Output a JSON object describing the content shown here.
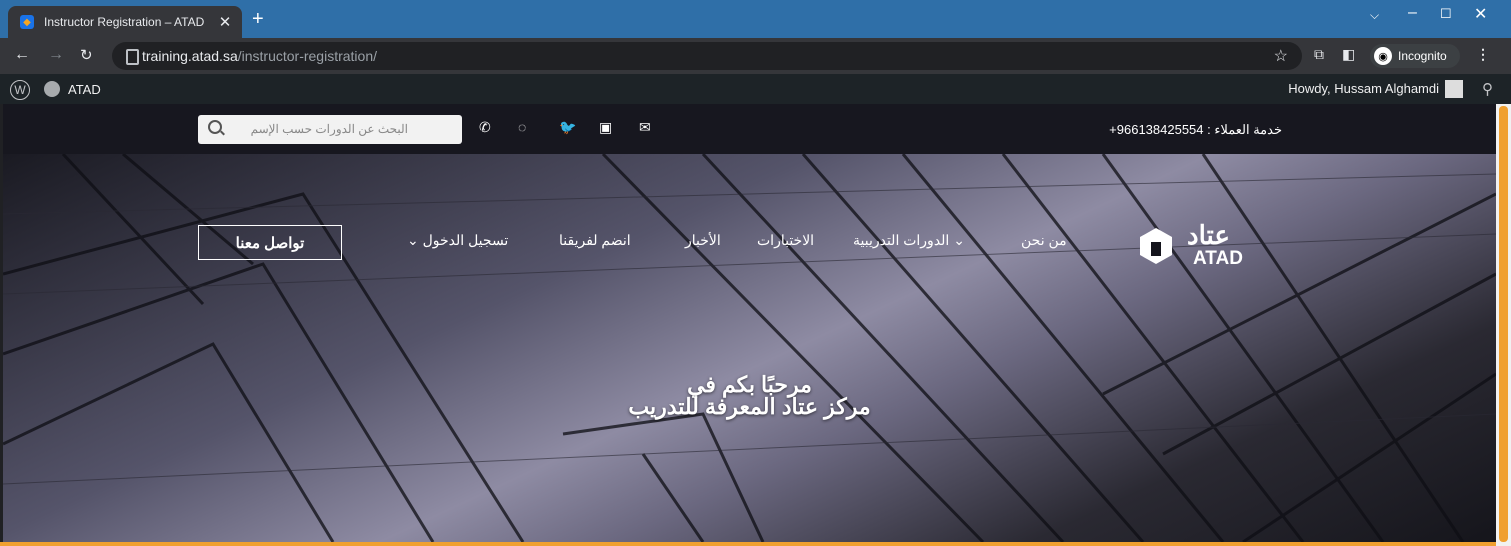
{
  "browser": {
    "tab_title": "Instructor Registration – ATAD",
    "url_domain": "training.atad.sa",
    "url_path": "/instructor-registration/",
    "incognito_label": "Incognito"
  },
  "wp_admin": {
    "site_name": "ATAD",
    "howdy": "Howdy, Hussam Alghamdi"
  },
  "topbar": {
    "search_placeholder": "البحث عن الدورات حسب الإسم",
    "customer_service": "خدمة العملاء : 966138425554+"
  },
  "nav": {
    "about": "من نحن",
    "courses": "الدورات التدريبية",
    "exams": "الاختبارات",
    "news": "الأخبار",
    "join": "انضم لفريقنا",
    "login": "تسجيل الدخول",
    "contact_button": "تواصل معنا"
  },
  "logo": {
    "arabic": "عتاد",
    "english": "ATAD"
  },
  "hero": {
    "line1": "مرحبًا بكم في",
    "line2": "مركز عتاد المعرفة للتدريب"
  },
  "colors": {
    "accent": "#f0a030",
    "tabbar": "#2f6fa8",
    "wpbar": "#1d2327"
  }
}
